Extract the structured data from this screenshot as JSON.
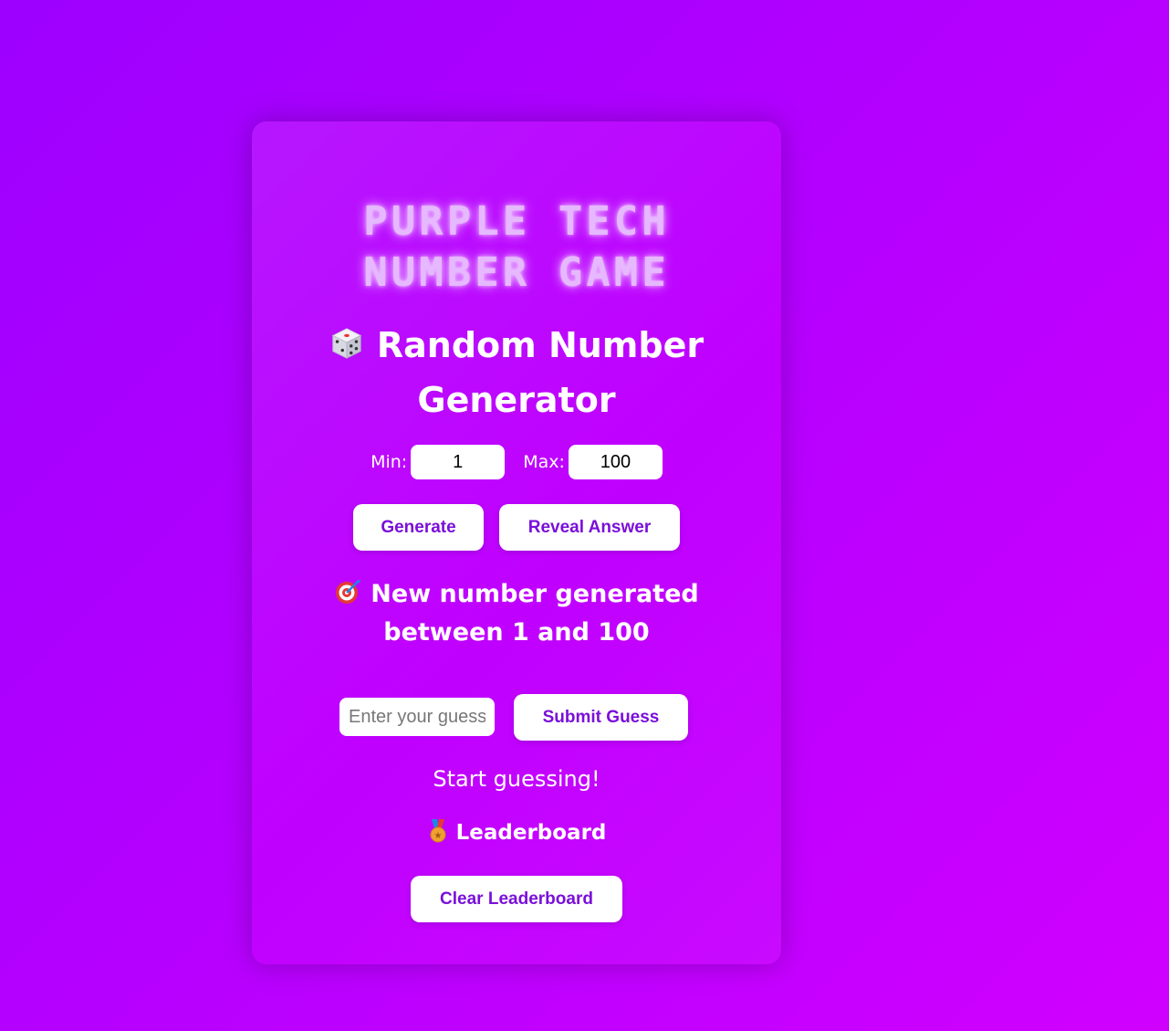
{
  "title": {
    "line1": "PURPLE TECH",
    "line2": "NUMBER GAME"
  },
  "generator": {
    "heading": "Random Number Generator",
    "icon": "dice-icon",
    "min_label": "Min:",
    "min_value": "1",
    "max_label": "Max:",
    "max_value": "100",
    "generate_label": "Generate",
    "reveal_label": "Reveal Answer"
  },
  "status": {
    "icon": "target-icon",
    "text": "New number generated between 1 and 100"
  },
  "guess": {
    "placeholder": "Enter your guess",
    "submit_label": "Submit Guess"
  },
  "feedback": "Start guessing!",
  "leaderboard": {
    "icon": "medal-icon",
    "title": "Leaderboard",
    "clear_label": "Clear Leaderboard"
  },
  "colors": {
    "accent": "#7a0fd9",
    "title_glow": "#e6b8ff",
    "background": "#b300ff"
  }
}
